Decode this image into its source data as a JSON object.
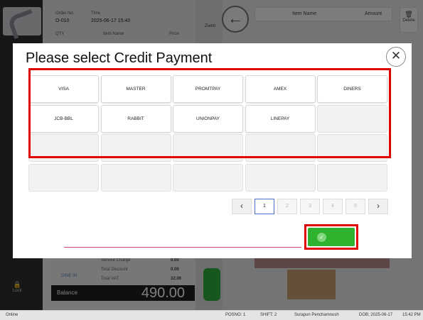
{
  "background": {
    "order_no_label": "Order No.",
    "order_no": "O-010",
    "time_label": "Time",
    "time": "2025-06-17 15:40",
    "col_qty": "QTY",
    "col_item_name": "Item Name",
    "col_price": "Price",
    "zoom_label": "Zoom",
    "right_col_item_name": "Item Name",
    "right_col_amount": "Amount",
    "delete_label": "Delete",
    "service_charge_label": "Service Charge",
    "service_charge": "0.00",
    "total_discount_label": "Total Discount",
    "total_discount": "0.00",
    "total_vat_label": "Total VAT",
    "total_vat": "32.06",
    "dine_in_label": "DINE IN",
    "balance_label": "Balance",
    "balance": "490.00",
    "lock_label": "Lock"
  },
  "status_bar": {
    "connection": "Online",
    "posno": "POSNO: 1",
    "shift": "SHIFT: 2",
    "user": "Surapun Penchamnush",
    "dob": "DOB: 2025-06-17",
    "clock": "15:42 PM"
  },
  "modal": {
    "title": "Please select Credit Payment",
    "close_icon": "close-icon",
    "tiles": [
      "VISA",
      "MASTER",
      "PROMTPAY",
      "AMEX",
      "DINERS",
      "JCB-BBL",
      "RABBIT",
      "UNIONPAY",
      "LINEPAY",
      "",
      "",
      "",
      "",
      "",
      "",
      "",
      "",
      "",
      "",
      ""
    ],
    "pagination": {
      "prev_icon": "chevron-left-icon",
      "next_icon": "chevron-right-icon",
      "pages": [
        "1",
        "2",
        "3",
        "4",
        "5"
      ],
      "current_page": "1"
    },
    "amount_placeholder": "",
    "confirm_icon": "check-circle-icon",
    "highlight_color": "#e00000",
    "confirm_color": "#2db32d"
  }
}
